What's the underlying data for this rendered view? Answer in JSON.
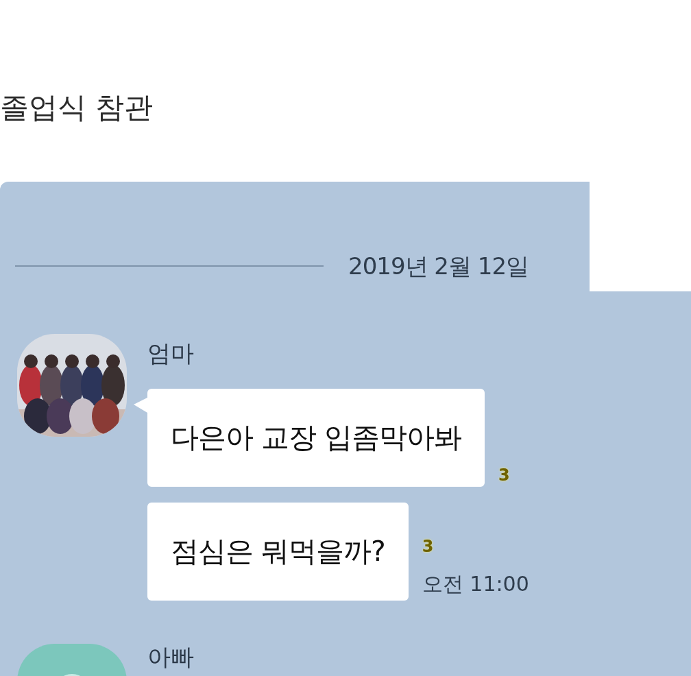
{
  "title": "졸업식 참관",
  "chat": {
    "date": "2019년 2월 12일",
    "groups": [
      {
        "sender": "엄마",
        "messages": [
          {
            "text": "다은아 교장 입좀막아봐",
            "unread": "3"
          },
          {
            "text": "점심은 뭐먹을까?",
            "unread": "3",
            "time": "오전 11:00"
          }
        ]
      },
      {
        "sender": "아빠",
        "avatar": {
          "kind": "default"
        }
      }
    ]
  }
}
